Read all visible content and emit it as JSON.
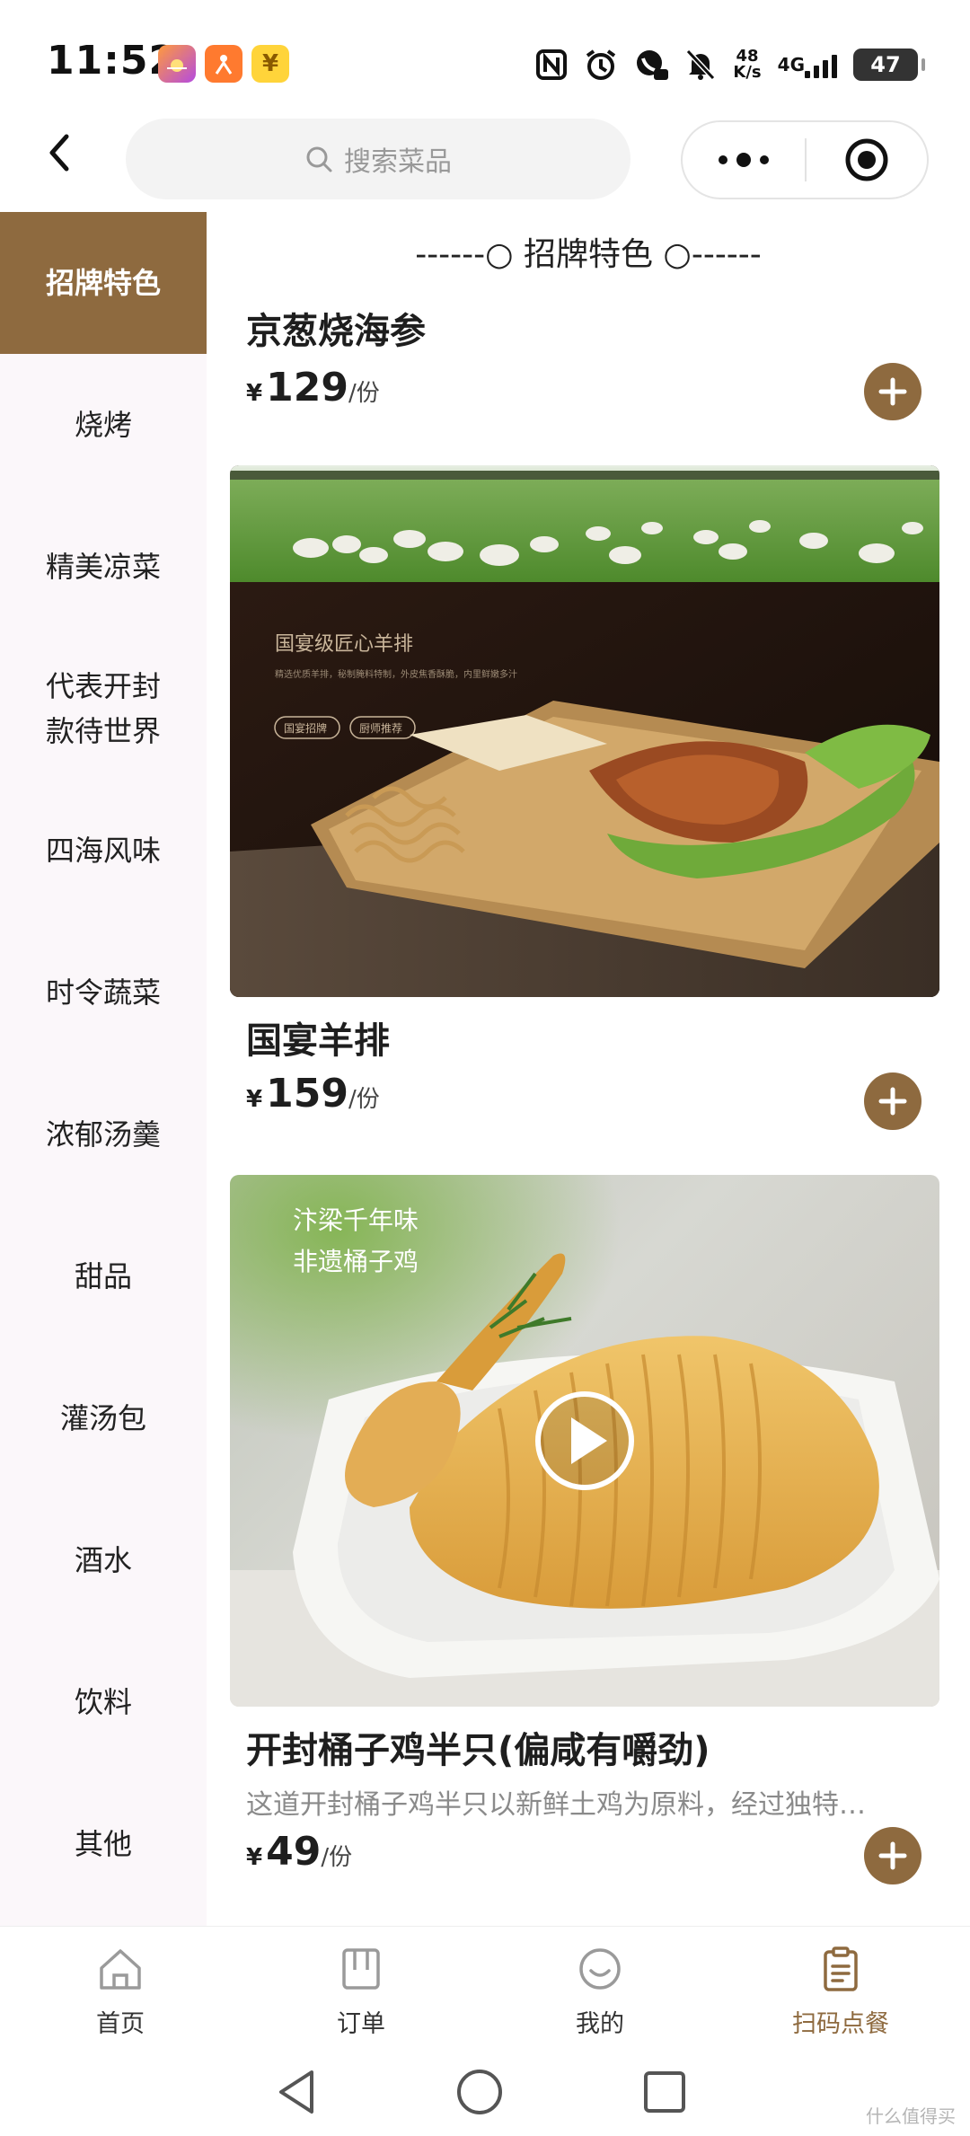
{
  "status_bar": {
    "time": "11:52",
    "badge_3_glyph": "¥",
    "net_speed": "48",
    "net_speed_unit": "K/s",
    "network": "4G",
    "battery": "47"
  },
  "search": {
    "placeholder": "搜索菜品"
  },
  "sidebar": {
    "items": [
      {
        "label": "招牌特色",
        "active": true
      },
      {
        "label": "烧烤"
      },
      {
        "label": "精美凉菜"
      },
      {
        "label": "代表开封\n款待世界"
      },
      {
        "label": "四海风味"
      },
      {
        "label": "时令蔬菜"
      },
      {
        "label": "浓郁汤羹"
      },
      {
        "label": "甜品"
      },
      {
        "label": "灌汤包"
      },
      {
        "label": "酒水"
      },
      {
        "label": "饮料"
      },
      {
        "label": "其他"
      }
    ]
  },
  "main": {
    "section_title": "------○ 招牌特色 ○------",
    "dishes": [
      {
        "name": "京葱烧海参",
        "currency": "¥",
        "price": "129",
        "unit": "/份"
      },
      {
        "name": "国宴羊排",
        "currency": "¥",
        "price": "159",
        "unit": "/份",
        "image_caption": "国宴级匠心羊排",
        "image_subcaption": "精选优质羊排，秘制腌料特制，外皮焦香酥脆，内里鲜嫩多汁",
        "image_badge_1": "国宴招牌",
        "image_badge_2": "厨师推荐"
      },
      {
        "name": "开封桶子鸡半只(偏咸有嚼劲)",
        "currency": "¥",
        "price": "49",
        "unit": "/份",
        "description": "这道开封桶子鸡半只以新鲜土鸡为原料，经过独特…",
        "image_caption_1": "汴梁千年味",
        "image_caption_2": "非遗桶子鸡"
      }
    ]
  },
  "tabbar": {
    "tabs": [
      {
        "label": "首页",
        "icon": "home-icon"
      },
      {
        "label": "订单",
        "icon": "orders-icon"
      },
      {
        "label": "我的",
        "icon": "smile-icon"
      },
      {
        "label": "扫码点餐",
        "icon": "clipboard-icon",
        "active": true
      }
    ]
  },
  "watermark": "什么值得买",
  "colors": {
    "accent": "#8e6a3f",
    "sidebar_bg": "#fbf7fa",
    "text": "#1e1e1e"
  }
}
